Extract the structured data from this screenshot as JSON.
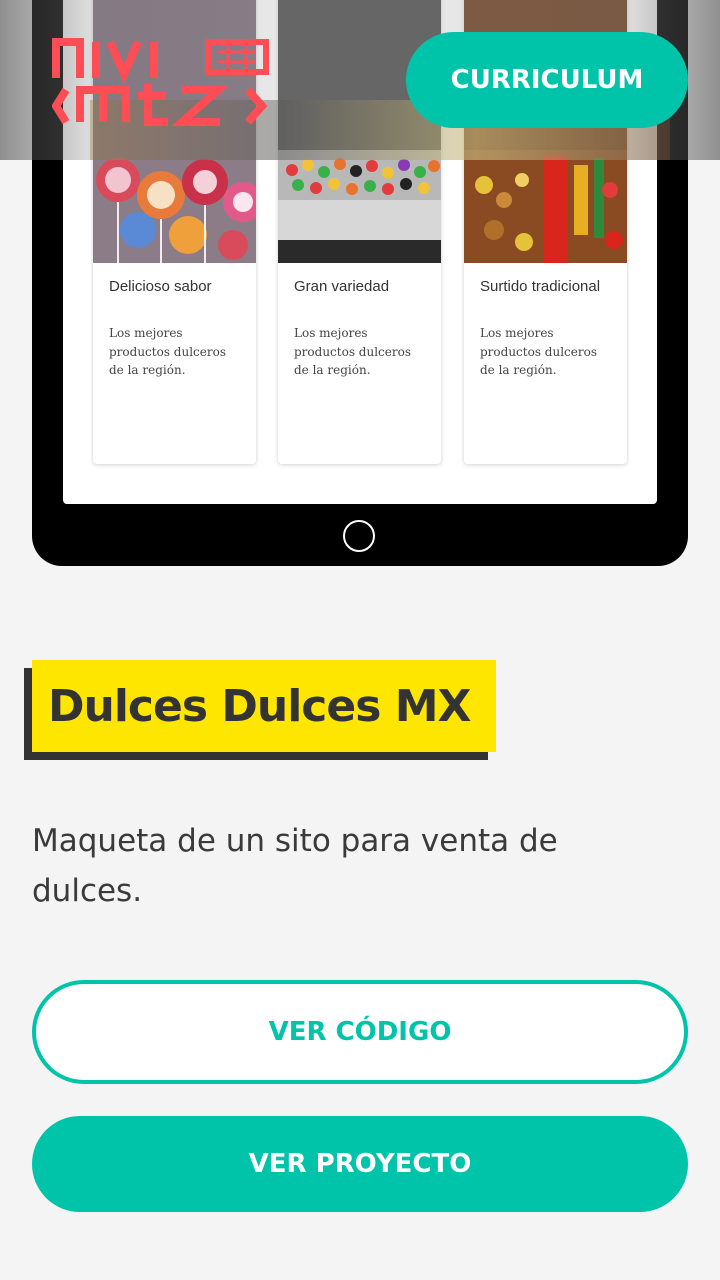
{
  "header": {
    "logo_alt": "nivi mtz",
    "curriculum_label": "CURRICULUM"
  },
  "tablet": {
    "cards": [
      {
        "title": "Delicioso sabor",
        "text": "Los mejores productos dulceros de la región.",
        "image": "lollipops-image"
      },
      {
        "title": "Gran variedad",
        "text": "Los mejores productos dulceros de la región.",
        "image": "candy-bins-image"
      },
      {
        "title": "Surtido tradicional",
        "text": "Los mejores productos dulceros de la región.",
        "image": "candy-market-image"
      }
    ]
  },
  "project": {
    "title": "Dulces Dulces MX",
    "description": "Maqueta de un sito para venta de dulces.",
    "code_button": "VER CÓDIGO",
    "project_button": "VER PROYECTO"
  },
  "colors": {
    "accent": "#00c4aa",
    "highlight": "#ffe600",
    "logo": "#ff4d55",
    "text": "#333333"
  }
}
